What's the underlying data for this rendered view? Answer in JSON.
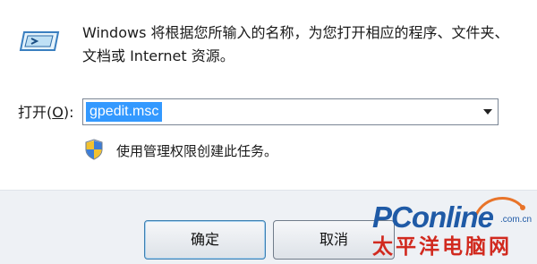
{
  "dialog": {
    "description": "Windows 将根据您所输入的名称，为您打开相应的程序、文件夹、文档或 Internet 资源。",
    "open_label": "打开",
    "open_shortcut": "O",
    "open_suffix": "):",
    "open_value": "gpedit.msc",
    "admin_note": "使用管理权限创建此任务。"
  },
  "buttons": {
    "ok_label": "确定",
    "cancel_label": "取消"
  },
  "watermark": {
    "brand": "PConline",
    "domain": ".com.cn",
    "cn_name": "太平洋电脑网"
  },
  "icons": {
    "app": "run-dialog-icon",
    "shield": "uac-shield-icon"
  },
  "colors": {
    "selection": "#3399ff",
    "brand_blue": "#1f5aa6",
    "brand_red": "#d12a1f"
  }
}
